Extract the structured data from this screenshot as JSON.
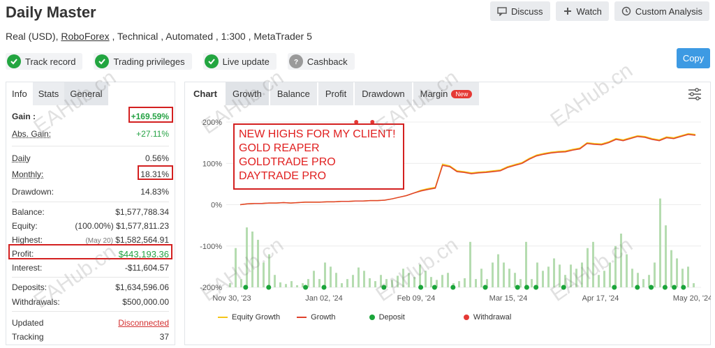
{
  "header": {
    "title": "Daily Master",
    "subtitle_prefix": "Real (USD), ",
    "broker": "RoboForex",
    "subtitle_suffix": " , Technical , Automated , 1:300 , MetaTrader 5",
    "buttons": {
      "discuss": "Discuss",
      "watch": "Watch",
      "custom": "Custom Analysis"
    }
  },
  "badges": [
    {
      "label": "Track record",
      "icon": "check-icon",
      "color": "#22a540"
    },
    {
      "label": "Trading privileges",
      "icon": "check-icon",
      "color": "#22a540"
    },
    {
      "label": "Live update",
      "icon": "check-icon",
      "color": "#22a540"
    },
    {
      "label": "Cashback",
      "icon": "help-icon",
      "color": "#9a9a9a"
    }
  ],
  "copy_label": "Copy",
  "left_tabs": [
    "Info",
    "Stats",
    "General"
  ],
  "stats": {
    "gain": {
      "label": "Gain :",
      "value": "+169.59%"
    },
    "abs_gain": {
      "label": "Abs. Gain:",
      "value": "+27.11%"
    },
    "daily": {
      "label": "Daily",
      "value": "0.56%"
    },
    "monthly": {
      "label": "Monthly:",
      "value": "18.31%"
    },
    "drawdown": {
      "label": "Drawdown:",
      "value": "14.83%"
    },
    "balance": {
      "label": "Balance:",
      "value": "$1,577,788.34"
    },
    "equity": {
      "label": "Equity:",
      "prefix": "(100.00%)",
      "value": "$1,577,811.23"
    },
    "highest": {
      "label": "Highest:",
      "prefix": "(May 20)",
      "value": "$1,582,564.91"
    },
    "profit": {
      "label": "Profit:",
      "value": "$443,193.36"
    },
    "interest": {
      "label": "Interest:",
      "value": "-$11,604.57"
    },
    "deposits": {
      "label": "Deposits:",
      "value": "$1,634,596.06"
    },
    "withdrawals": {
      "label": "Withdrawals:",
      "value": "$500,000.00"
    },
    "updated": {
      "label": "Updated",
      "value": "Disconnected"
    },
    "tracking": {
      "label": "Tracking",
      "value": "37"
    }
  },
  "chart_tabs": {
    "chart": "Chart",
    "growth": "Growth",
    "balance": "Balance",
    "profit": "Profit",
    "drawdown": "Drawdown",
    "margin": "Margin",
    "new": "New"
  },
  "annotation": [
    "NEW HIGHS FOR MY CLIENT!",
    "GOLD REAPER",
    "GOLDTRADE PRO",
    "DAYTRADE PRO"
  ],
  "legend": {
    "equity_growth": "Equity Growth",
    "growth": "Growth",
    "deposit": "Deposit",
    "withdrawal": "Withdrawal"
  },
  "colors": {
    "equity": "#f5c518",
    "growth": "#e0412b",
    "deposit": "#1aa53a",
    "withdrawal": "#e53935",
    "bars": "#b5dcb0"
  },
  "watermark": "EAHub.cn",
  "chart_data": {
    "type": "line",
    "y_ticks": [
      "200%",
      "100%",
      "0%",
      "-100%",
      "-200%"
    ],
    "ylim": [
      -200,
      200
    ],
    "x_ticks": [
      "Nov 30, '23",
      "Jan 02, '24",
      "Feb 09, '24",
      "Mar 15, '24",
      "Apr 17, '24",
      "May 20, '24"
    ],
    "growth": [
      0,
      2,
      3,
      3,
      4,
      4,
      5,
      4,
      5,
      6,
      6,
      6,
      7,
      7,
      8,
      8,
      9,
      9,
      10,
      10,
      11,
      14,
      18,
      22,
      28,
      33,
      37,
      40,
      95,
      92,
      80,
      78,
      75,
      77,
      78,
      80,
      82,
      90,
      95,
      100,
      110,
      118,
      122,
      125,
      127,
      128,
      132,
      135,
      148,
      146,
      145,
      150,
      158,
      155,
      160,
      165,
      163,
      158,
      155,
      162,
      160,
      165,
      170,
      168
    ],
    "equity_growth": [
      0,
      2,
      3,
      3,
      4,
      4,
      5,
      4,
      5,
      6,
      6,
      6,
      7,
      7,
      8,
      8,
      9,
      9,
      10,
      10,
      11,
      14,
      18,
      22,
      28,
      35,
      39,
      42,
      98,
      94,
      82,
      80,
      77,
      79,
      80,
      82,
      84,
      92,
      97,
      102,
      112,
      120,
      124,
      127,
      129,
      130,
      134,
      137,
      150,
      148,
      147,
      152,
      160,
      157,
      162,
      167,
      165,
      160,
      157,
      164,
      162,
      167,
      172,
      170
    ],
    "bars": [
      10,
      95,
      20,
      145,
      135,
      115,
      60,
      80,
      30,
      12,
      8,
      15,
      5,
      10,
      20,
      40,
      20,
      60,
      50,
      35,
      10,
      20,
      30,
      48,
      40,
      22,
      15,
      30,
      20,
      18,
      28,
      45,
      35,
      25,
      55,
      40,
      25,
      18,
      30,
      35,
      10,
      15,
      22,
      110,
      20,
      45,
      20,
      60,
      80,
      60,
      45,
      35,
      20,
      110,
      20,
      60,
      40,
      50,
      70,
      55,
      30,
      55,
      45,
      60,
      95,
      110,
      30,
      40,
      60,
      100,
      130,
      80,
      45,
      35,
      20,
      30,
      60,
      215,
      150,
      90,
      70,
      45,
      50,
      10
    ]
  }
}
